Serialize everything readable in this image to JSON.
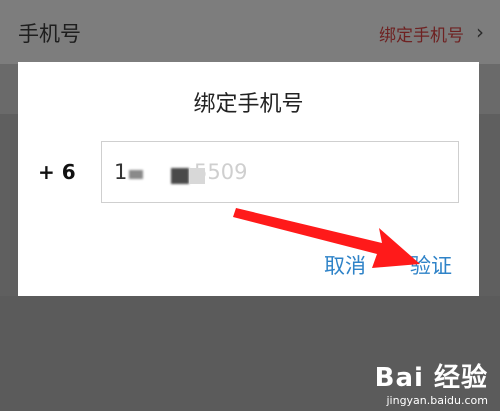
{
  "background": {
    "row_title": "手机号",
    "row_value": "绑定手机号",
    "chevron": "chevron-right-icon"
  },
  "dialog": {
    "title": "绑定手机号",
    "country_code": "+ 6",
    "phone_value": "1",
    "phone_tail": "5509",
    "cancel_label": "取消",
    "verify_label": "验证"
  },
  "annotation": {
    "arrow_color": "#ff1a1a",
    "icon": "arrow-icon"
  },
  "watermark": {
    "logo_text": "Bai 经验",
    "url": "jingyan.baidu.com"
  },
  "colors": {
    "link_blue": "#2f83c8",
    "overlay": "#5b5b5b"
  }
}
